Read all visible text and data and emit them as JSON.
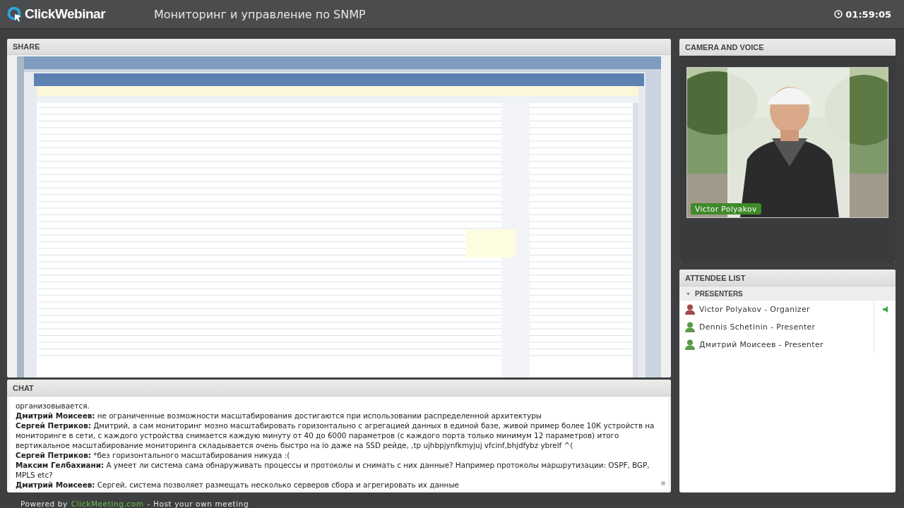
{
  "header": {
    "logo": "ClickWebinar",
    "title": "Мониторинг и управление по SNMP",
    "timer": "01:59:05"
  },
  "share": {
    "title": "SHARE"
  },
  "chat": {
    "title": "CHAT",
    "messages": [
      {
        "text": "организовывается."
      },
      {
        "author": "Дмитрий Моисеев:",
        "text": "не ограниченные возможности масштабирования достигаются при использовании распределенной архитектуры"
      },
      {
        "author": "Сергей Петриков:",
        "text": "Дмитрий, а сам мониторинг мозно масштабировать горизонтально с агрегацией данных в единой базе, живой пример более 10К устройств на мониторинге в сети, с каждого устройства снимается каждую минуту от 40 до 6000 параметров (с каждого порта только минимум 12 параметров) итого вертикальное масштабирование мониторинга складывается очень быстро на io даже на SSD рейде, ,tp ujhbpjynfkmyjuj vfcinf,bhjdfybz ybrelf ^("
      },
      {
        "author": "Сергей Петриков:",
        "text": "*без горизонтального масштабирования никуда :("
      },
      {
        "author": "Максим Гелбахиани:",
        "text": "А умеет ли система сама обнаруживать процессы и протоколы и снимать с них данные? Например протоколы маршрутизации: OSPF, BGP, MPLS etc?"
      },
      {
        "author": "Дмитрий Моисеев:",
        "text": "Сергей, система позволяет размещать несколько серверов сбора и агрегировать их данные"
      }
    ]
  },
  "camera": {
    "title": "CAMERA AND VOICE",
    "name": "Victor Polyakov"
  },
  "attendees": {
    "title": "ATTENDEE LIST",
    "groups": [
      {
        "label": "PRESENTERS",
        "expanded": true,
        "members": [
          {
            "name": "Victor Polyakov - Organizer",
            "color": "#a04a4a",
            "speaking": true
          },
          {
            "name": "Dennis Schetinin - Presenter",
            "color": "#5c9a4a",
            "speaking": false
          },
          {
            "name": "Дмитрий Моисеев - Presenter",
            "color": "#5c9a4a",
            "speaking": false
          }
        ]
      }
    ]
  },
  "footer": {
    "prefix": "Powered by",
    "link": "ClickMeeting.com",
    "suffix": "- Host your own meeting"
  }
}
